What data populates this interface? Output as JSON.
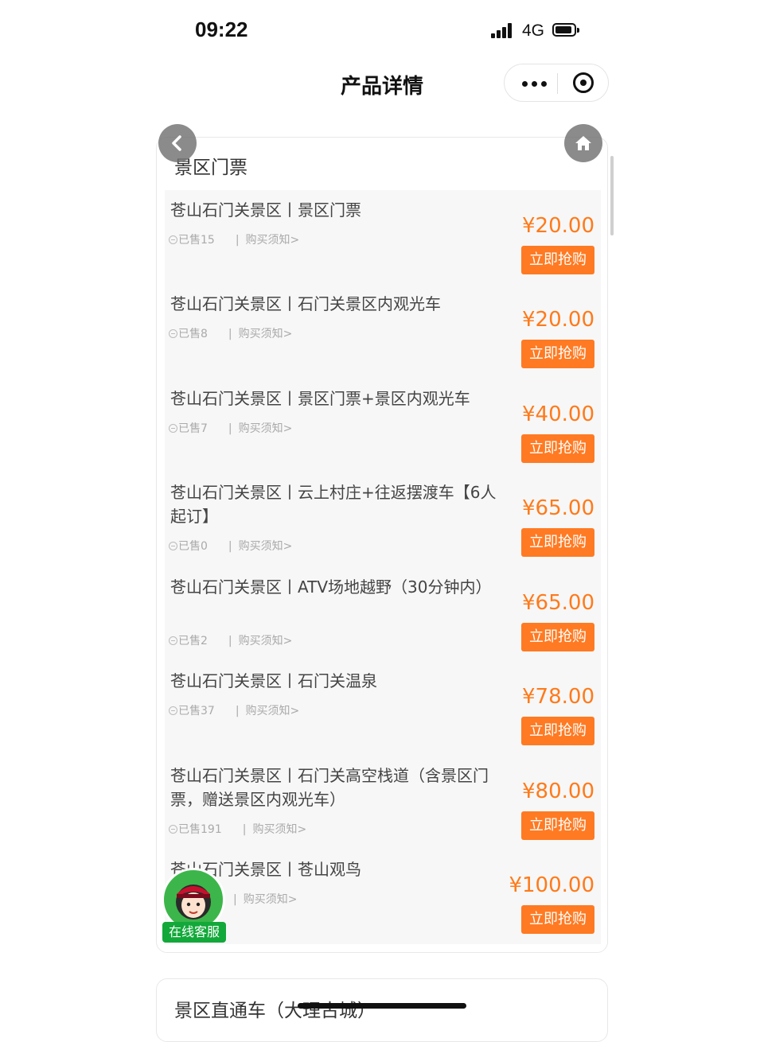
{
  "status_bar": {
    "time": "09:22",
    "network": "4G",
    "signal_icon": "signal-bars-icon",
    "battery_icon": "battery-icon"
  },
  "nav": {
    "title": "产品详情",
    "more_icon": "more-dots-icon",
    "close_icon": "miniprogram-close-icon",
    "back_icon": "chevron-left-icon",
    "home_icon": "home-icon"
  },
  "section": {
    "title": "景区门票"
  },
  "items": [
    {
      "name": "苍山石门关景区丨景区门票",
      "sold": "已售15",
      "notice": "购买须知>",
      "price": "¥20.00",
      "button": "立即抢购"
    },
    {
      "name": "苍山石门关景区丨石门关景区内观光车",
      "sold": "已售8",
      "notice": "购买须知>",
      "price": "¥20.00",
      "button": "立即抢购"
    },
    {
      "name": "苍山石门关景区丨景区门票+景区内观光车",
      "sold": "已售7",
      "notice": "购买须知>",
      "price": "¥40.00",
      "button": "立即抢购"
    },
    {
      "name": "苍山石门关景区丨云上村庄+往返摆渡车【6人起订】",
      "sold": "已售0",
      "notice": "购买须知>",
      "price": "¥65.00",
      "button": "立即抢购"
    },
    {
      "name": "苍山石门关景区丨ATV场地越野（30分钟内）",
      "sold": "已售2",
      "notice": "购买须知>",
      "price": "¥65.00",
      "button": "立即抢购"
    },
    {
      "name": "苍山石门关景区丨石门关温泉",
      "sold": "已售37",
      "notice": "购买须知>",
      "price": "¥78.00",
      "button": "立即抢购"
    },
    {
      "name": "苍山石门关景区丨石门关高空栈道（含景区门票，赠送景区内观光车）",
      "sold": "已售191",
      "notice": "购买须知>",
      "price": "¥80.00",
      "button": "立即抢购"
    },
    {
      "name": "苍山石门关景区丨苍山观鸟",
      "sold": "",
      "notice": "购买须知>",
      "price": "¥100.00",
      "button": "立即抢购"
    }
  ],
  "customer_service": {
    "label": "在线客服",
    "avatar_icon": "customer-service-avatar-icon"
  },
  "section2": {
    "title": "景区直通车（大理古城）"
  },
  "colors": {
    "accent": "#ff7a22",
    "service_green": "#13a83a"
  }
}
